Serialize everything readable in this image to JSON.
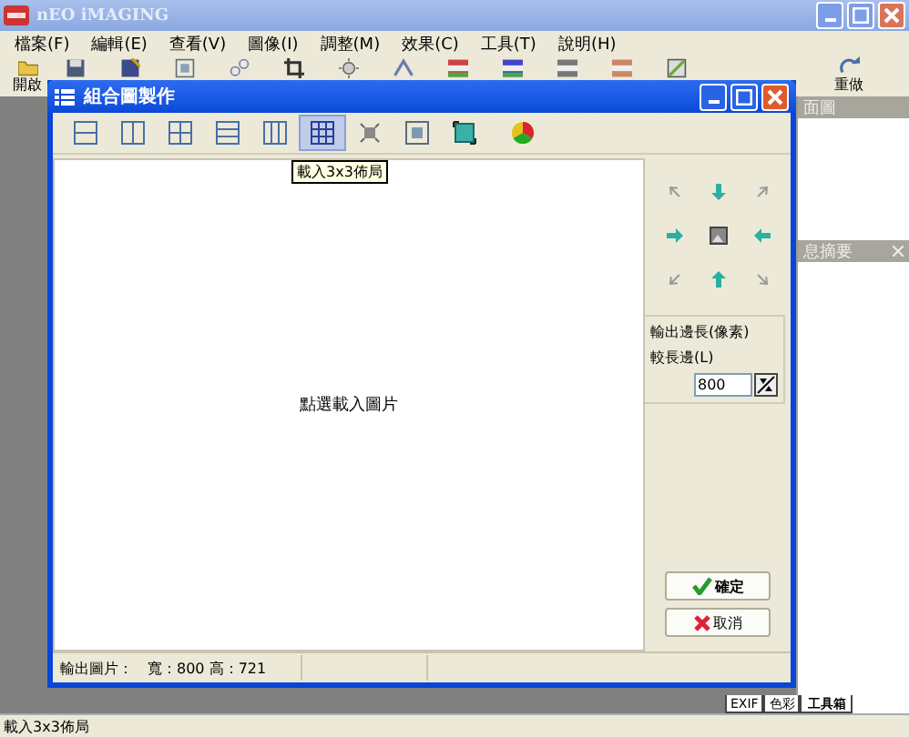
{
  "window": {
    "title": "nEO iMAGING"
  },
  "menu": [
    "檔案(F)",
    "編輯(E)",
    "查看(V)",
    "圖像(I)",
    "調整(M)",
    "效果(C)",
    "工具(T)",
    "說明(H)"
  ],
  "toolbar": [
    {
      "kind": "labeled",
      "label": "開啟"
    },
    {
      "kind": "icon"
    },
    {
      "kind": "icon"
    },
    {
      "kind": "icon"
    },
    {
      "kind": "dropdown"
    },
    {
      "kind": "dropdown"
    },
    {
      "kind": "icon"
    },
    {
      "kind": "dropdown"
    },
    {
      "kind": "dropdown"
    },
    {
      "kind": "icon"
    },
    {
      "kind": "dropdown"
    },
    {
      "kind": "dropdown"
    },
    {
      "kind": "dropdown"
    },
    {
      "kind": "labeled",
      "label": "重做"
    }
  ],
  "side_panel": {
    "headers": [
      {
        "label": "面圖",
        "closable": false
      },
      {
        "label": "息摘要",
        "closable": true
      }
    ],
    "tabs": [
      {
        "label": "EXIF",
        "selected": false
      },
      {
        "label": "色彩",
        "selected": false
      },
      {
        "label": "工具箱",
        "selected": true
      }
    ]
  },
  "dialog": {
    "title": "組合圖製作",
    "layouts": [
      {
        "selected": false
      },
      {
        "selected": false
      },
      {
        "selected": false
      },
      {
        "selected": false
      },
      {
        "selected": false
      },
      {
        "selected": true
      },
      {
        "selected": false
      },
      {
        "selected": false
      },
      {
        "selected": false
      },
      {
        "selected": false
      }
    ],
    "tooltip": "載入3x3佈局",
    "canvas_hint": "點選載入圖片",
    "output": {
      "title": "輸出邊長(像素)",
      "field_label": "較長邊(L)",
      "value": "800"
    },
    "buttons": [
      {
        "kind": "ok",
        "label": "確定"
      },
      {
        "kind": "cancel",
        "label": "取消"
      }
    ],
    "status": [
      "輸出圖片：",
      "寬：800 高：721"
    ]
  },
  "status_bar": "載入3x3佈局"
}
